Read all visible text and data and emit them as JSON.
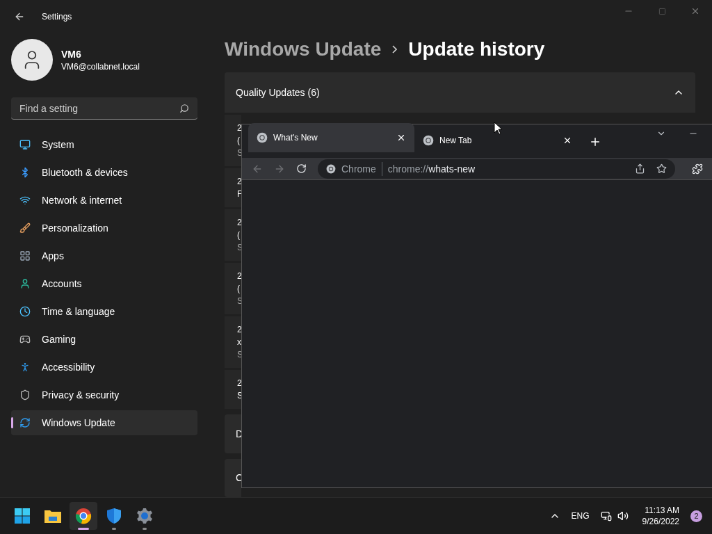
{
  "settings": {
    "title": "Settings",
    "user": {
      "name": "VM6",
      "email": "VM6@collabnet.local"
    },
    "search": {
      "placeholder": "Find a setting"
    },
    "nav": [
      {
        "label": "System",
        "selected": false
      },
      {
        "label": "Bluetooth & devices",
        "selected": false
      },
      {
        "label": "Network & internet",
        "selected": false
      },
      {
        "label": "Personalization",
        "selected": false
      },
      {
        "label": "Apps",
        "selected": false
      },
      {
        "label": "Accounts",
        "selected": false
      },
      {
        "label": "Time & language",
        "selected": false
      },
      {
        "label": "Gaming",
        "selected": false
      },
      {
        "label": "Accessibility",
        "selected": false
      },
      {
        "label": "Privacy & security",
        "selected": false
      },
      {
        "label": "Windows Update",
        "selected": true
      }
    ],
    "breadcrumb": [
      "Windows Update",
      "Update history"
    ],
    "section": {
      "title": "Quality Updates (6)",
      "expanded": true,
      "rows": [
        {
          "lines": [
            "2",
            "(",
            "S"
          ]
        },
        {
          "lines": [
            "2",
            "F"
          ]
        },
        {
          "lines": [
            "2",
            "(",
            "S"
          ]
        },
        {
          "lines": [
            "2",
            "(",
            "S"
          ]
        },
        {
          "lines": [
            "2",
            "x",
            "S"
          ]
        },
        {
          "lines": [
            "2",
            "S"
          ]
        }
      ]
    },
    "other_sections": [
      {
        "title": "D"
      },
      {
        "title": "C"
      }
    ]
  },
  "browser": {
    "tabs": [
      {
        "title": "What's New",
        "selected": true
      },
      {
        "title": "New Tab",
        "selected": false
      }
    ],
    "address": {
      "label": "Chrome",
      "url": "chrome://**whats-new**"
    }
  },
  "taskbar": {
    "apps": [
      {
        "kind": "start",
        "selected": false,
        "running": false
      },
      {
        "kind": "explorer",
        "selected": false,
        "running": false
      },
      {
        "kind": "chrome",
        "selected": true,
        "running": true
      },
      {
        "kind": "defender",
        "selected": false,
        "running": true
      },
      {
        "kind": "settings",
        "selected": false,
        "running": true
      }
    ],
    "language": "ENG",
    "time": "11:13 AM",
    "date": "9/26/2022",
    "notifications": "2"
  }
}
